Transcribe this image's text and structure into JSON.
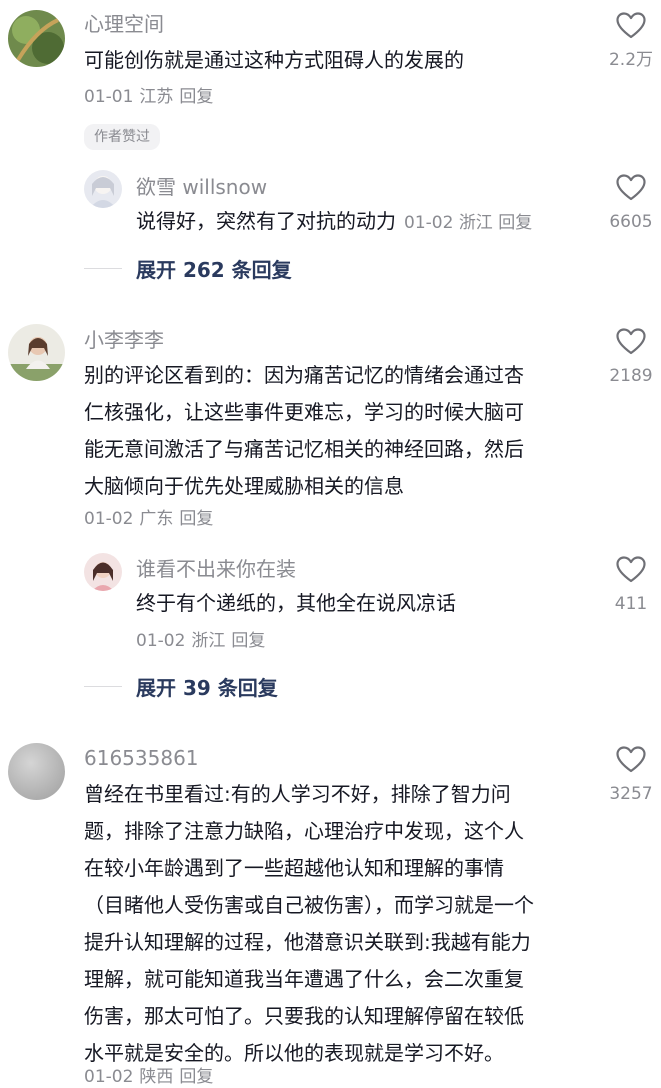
{
  "comments": [
    {
      "username": "心理空间",
      "text": "可能创伤就是通过这种方式阻碍人的发展的",
      "date": "01-01",
      "location": "江苏",
      "reply": "回复",
      "likes": "2.2万",
      "badge": "作者赞过",
      "replies": [
        {
          "username": "欲雪 willsnow",
          "text": "说得好，突然有了对抗的动力",
          "date": "01-02",
          "location": "浙江",
          "reply": "回复",
          "likes": "6605"
        }
      ],
      "expand": "展开 262 条回复"
    },
    {
      "username": "小李李李",
      "text_lines": [
        "别的评论区看到的：因为痛苦记忆的情绪会通过杏",
        "仁核强化，让这些事件更难忘，学习的时候大脑可",
        "能无意间激活了与痛苦记忆相关的神经回路，然后",
        "大脑倾向于优先处理威胁相关的信息"
      ],
      "date": "01-02",
      "location": "广东",
      "reply": "回复",
      "likes": "2189",
      "replies": [
        {
          "username": "谁看不出来你在装",
          "text": "终于有个递纸的，其他全在说风凉话",
          "date": "01-02",
          "location": "浙江",
          "reply": "回复",
          "likes": "411"
        }
      ],
      "expand": "展开 39 条回复"
    },
    {
      "username": "616535861",
      "text_lines": [
        "曾经在书里看过:有的人学习不好，排除了智力问",
        "题，排除了注意力缺陷，心理治疗中发现，这个人",
        "在较小年龄遇到了一些超越他认知和理解的事情",
        "（目睹他人受伤害或自己被伤害），而学习就是一个",
        "提升认知理解的过程，他潜意识关联到:我越有能力",
        "理解，就可能知道我当年遭遇了什么，会二次重复",
        "伤害，那太可怕了。只要我的认知理解停留在较低",
        "水平就是安全的。所以他的表现就是学习不好。"
      ],
      "date": "01-02",
      "location": "陕西",
      "reply": "回复",
      "likes": "3257"
    }
  ],
  "icons": {
    "like": "heart-outline-icon"
  },
  "colors": {
    "text": "#161823",
    "secondary": "#8a8b91",
    "expand": "#2a3a5e",
    "badge_bg": "#f2f2f4"
  }
}
